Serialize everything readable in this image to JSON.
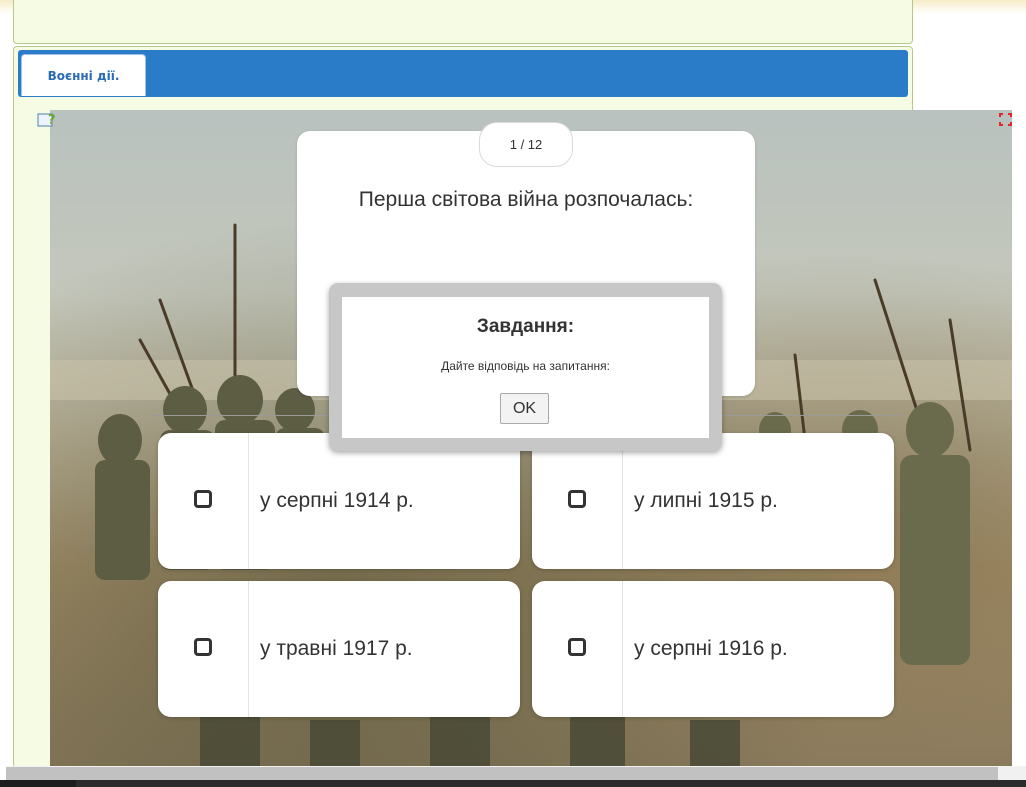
{
  "tab": {
    "label": "Воєнні дії."
  },
  "quiz": {
    "counter": "1 / 12",
    "question": "Перша світова війна розпочалась:",
    "answers": [
      {
        "label": "у серпні 1914 р."
      },
      {
        "label": "у липні 1915 р."
      },
      {
        "label": "у травні 1917 р."
      },
      {
        "label": "у серпні 1916 р."
      }
    ]
  },
  "dialog": {
    "title": "Завдання:",
    "text": "Дайте відповідь на запитання:",
    "ok_label": "OK"
  },
  "icons": {
    "help": "help-question-icon",
    "fullscreen": "fullscreen-icon",
    "checkbox": "checkbox-icon"
  },
  "colors": {
    "tab_bar": "#2a7bc8",
    "tab_text": "#2a6bb5",
    "panel_bg": "#f6fbe3"
  }
}
